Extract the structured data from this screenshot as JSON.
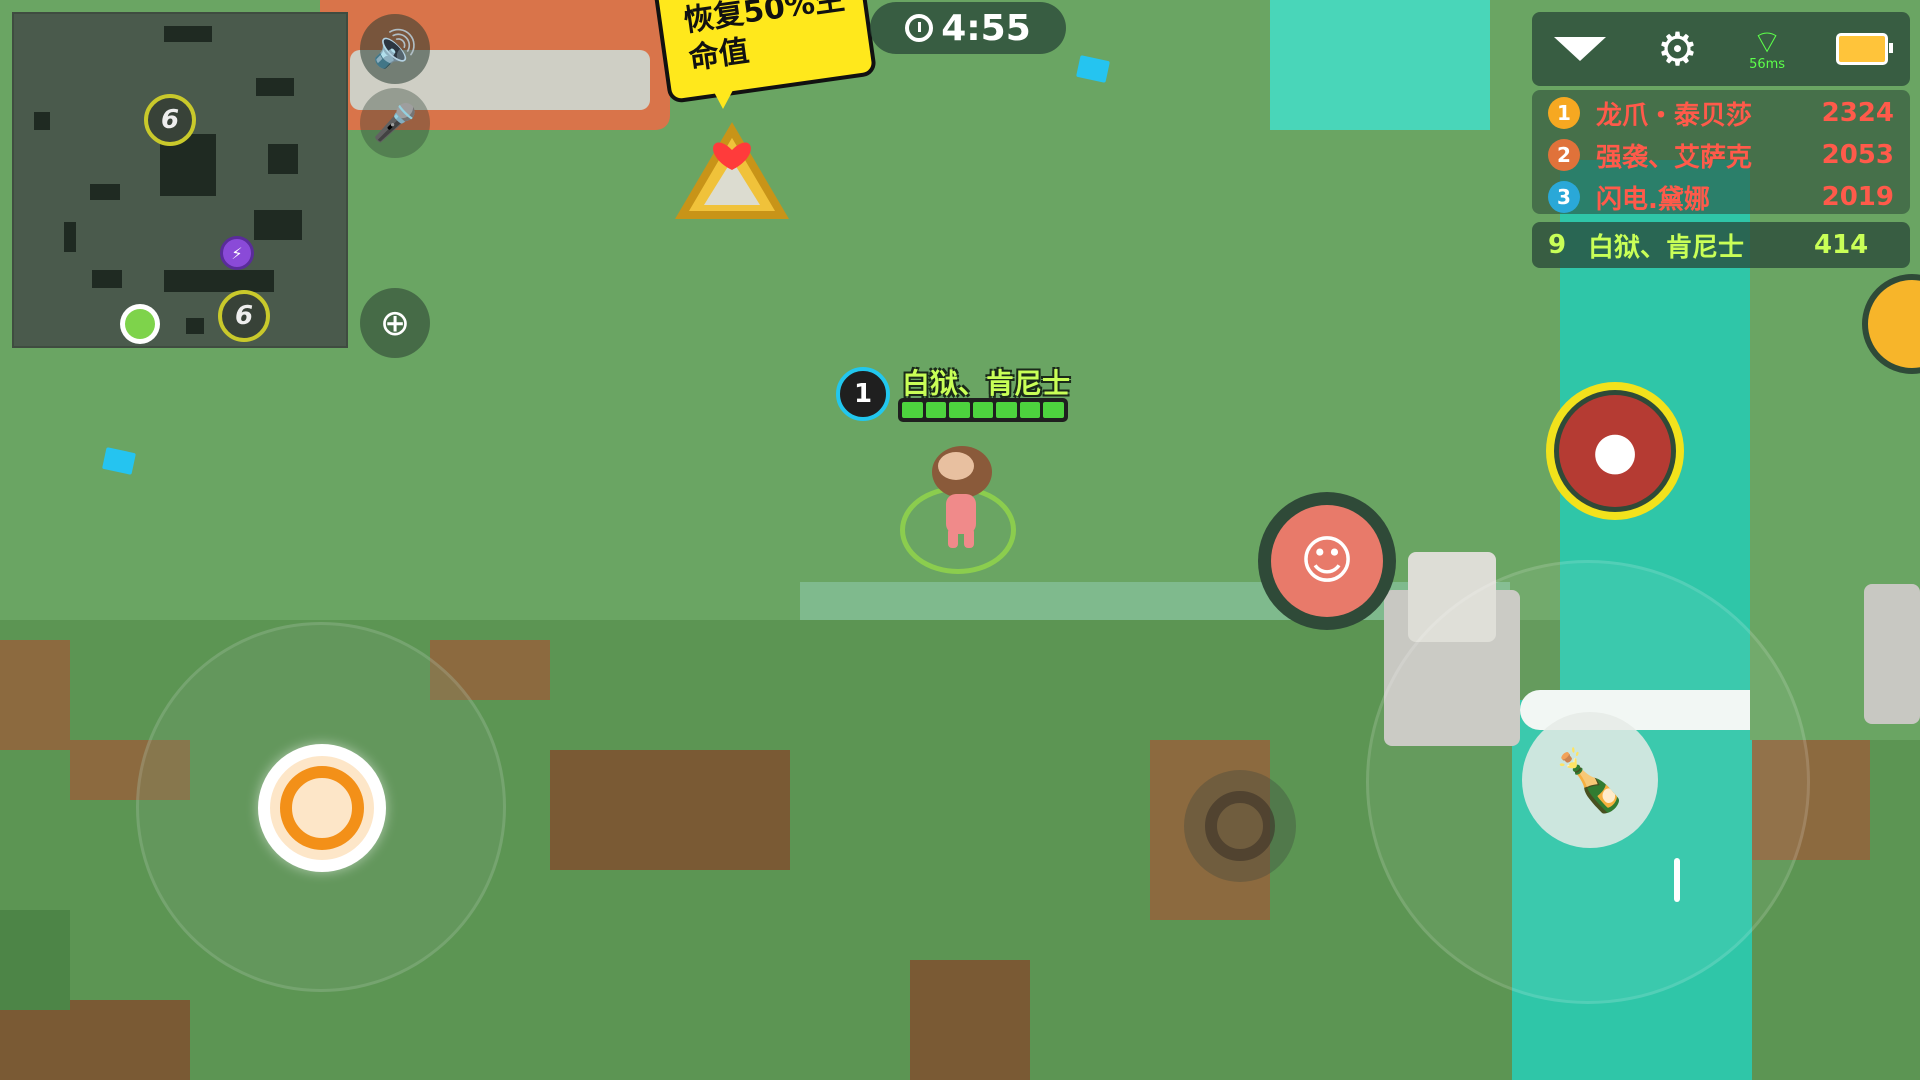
{
  "timer": {
    "time": "4:55",
    "icon": "clock-icon"
  },
  "bubble": {
    "line1": "恢复50%生",
    "line2": "命值"
  },
  "top_bar": {
    "dropdown_icon": "chevron-down-icon",
    "settings_icon": "gear-icon",
    "network": {
      "icon": "wifi-icon",
      "ping": "56ms"
    },
    "battery_icon": "battery-charging-icon"
  },
  "leaderboard": [
    {
      "rank": "1",
      "name": "龙爪・泰贝莎",
      "score": "2324",
      "rank_color": "#f6a821"
    },
    {
      "rank": "2",
      "name": "强袭、艾萨克",
      "score": "2053",
      "rank_color": "#e0723a"
    },
    {
      "rank": "3",
      "name": "闪电.黛娜",
      "score": "2019",
      "rank_color": "#2aa8d8"
    }
  ],
  "self_rank": {
    "rank": "9",
    "name": "白狱、肯尼士",
    "score": "414"
  },
  "player": {
    "level": "1",
    "name": "白狱、肯尼士",
    "health_segments": 7
  },
  "minimap": {
    "markers": [
      "6",
      "6"
    ]
  },
  "hud": {
    "sound_icon": "speaker-icon",
    "mic_icon": "microphone-muted-icon",
    "zoom_icon": "zoom-in-icon"
  },
  "colors": {
    "accent_green": "#c9ff57",
    "enemy_red": "#ff5a4a",
    "water": "#2fc6a8",
    "bubble": "#ffe81c"
  }
}
